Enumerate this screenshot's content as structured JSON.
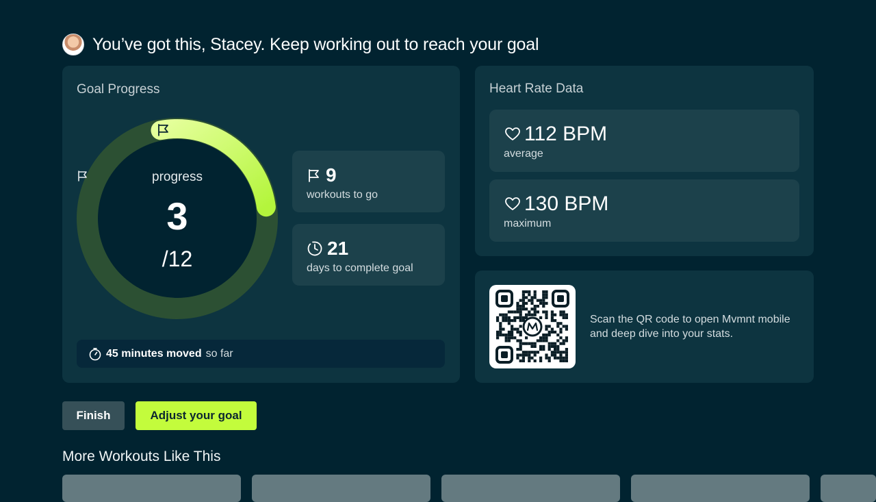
{
  "header": {
    "title": "You’ve got this, Stacey. Keep working out to reach your goal"
  },
  "goal": {
    "title": "Goal Progress",
    "ring_label": "progress",
    "progress_value": "3",
    "progress_total": "/12",
    "progress_fraction": 0.25,
    "workouts_value": "9",
    "workouts_label": "workouts to go",
    "days_value": "21",
    "days_label": "days to complete goal",
    "moved_strong": "45 minutes moved",
    "moved_rest": "so far"
  },
  "heart": {
    "title": "Heart Rate Data",
    "average_value": "112 BPM",
    "average_label": "average",
    "max_value": "130 BPM",
    "max_label": "maximum"
  },
  "qr": {
    "text": "Scan the QR code to open Mvmnt mobile and deep dive into your stats."
  },
  "buttons": {
    "finish": "Finish",
    "adjust": "Adjust your goal"
  },
  "more": {
    "title": "More Workouts Like This",
    "thumbnails": [
      "",
      "",
      "",
      "",
      ""
    ]
  },
  "colors": {
    "background": "#012330",
    "card": "#0d3440",
    "tile": "#1c414b",
    "accent": "#c3fc3c",
    "ring_track": "#2c5033"
  },
  "icons": [
    "flag-icon",
    "timer-icon",
    "stopwatch-icon",
    "heart-icon"
  ]
}
